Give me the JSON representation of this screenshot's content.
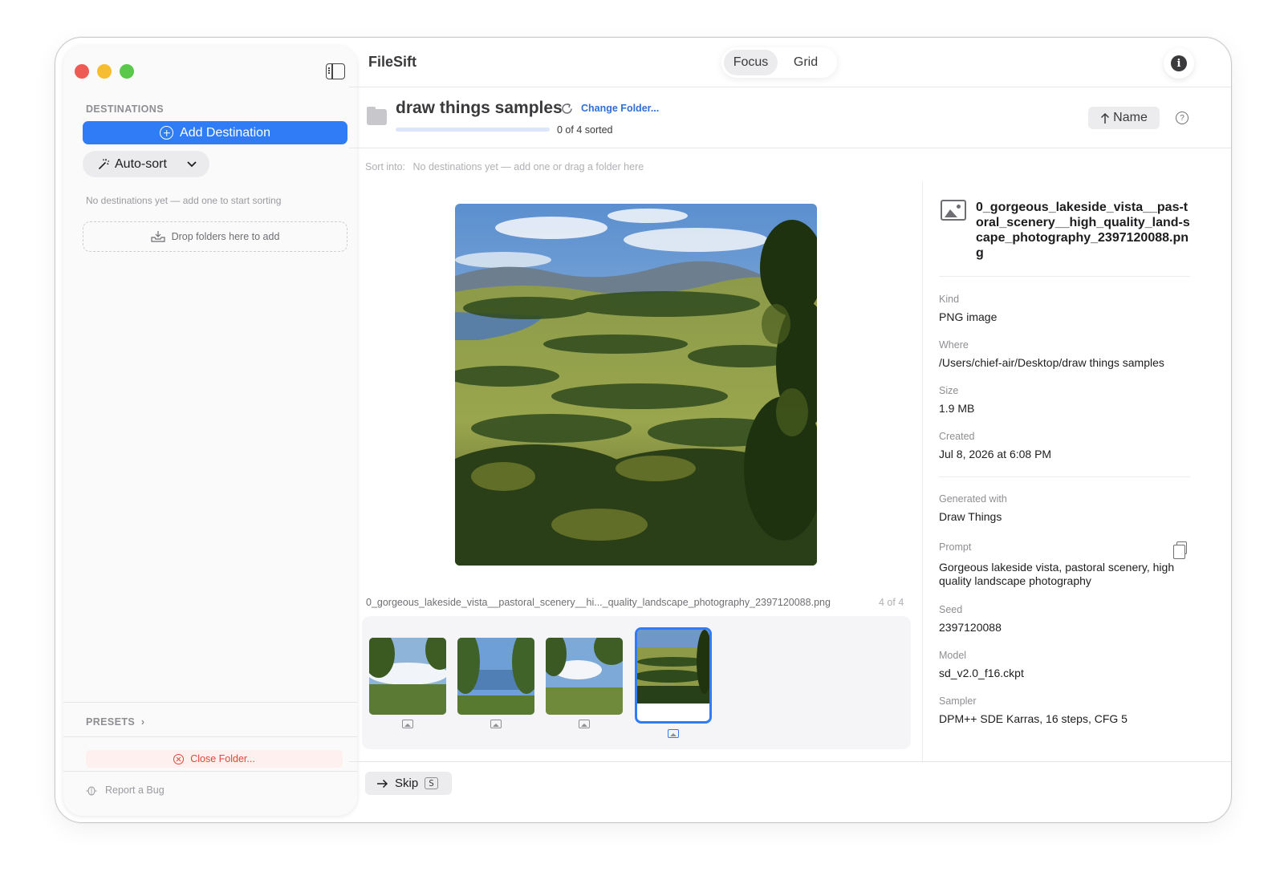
{
  "window": {
    "app_title": "FileSift",
    "view_modes": [
      {
        "label": "Focus",
        "active": true
      },
      {
        "label": "Grid",
        "active": false
      }
    ]
  },
  "sidebar": {
    "destinations_label": "DESTINATIONS",
    "add_destination_label": "Add Destination",
    "autosort_label": "Auto-sort",
    "empty_message": "No destinations yet — add one to start sorting",
    "dropzone_label": "Drop folders here to add",
    "presets_label": "PRESETS",
    "close_folder_label": "Close Folder...",
    "report_bug_label": "Report a Bug"
  },
  "folder": {
    "name": "draw things samples",
    "change_folder_label": "Change Folder...",
    "sorted_text": "0 of 4 sorted",
    "sorted_fraction": 0.0,
    "sort_button_label": "Name",
    "sort_into_label": "Sort into:",
    "sort_into_message": "No destinations yet — add one or drag a folder here"
  },
  "viewer": {
    "caption": "0_gorgeous_lakeside_vista__pastoral_scenery__hi..._quality_landscape_photography_2397120088.png",
    "position": "4 of 4",
    "thumbnails": [
      {
        "selected": false
      },
      {
        "selected": false
      },
      {
        "selected": false
      },
      {
        "selected": true
      }
    ],
    "skip_label": "Skip",
    "skip_shortcut": "S"
  },
  "info": {
    "file_name": "0_gorgeous_lakeside_vista__pas-toral_scenery__high_quality_land-scape_photography_2397120088.png",
    "kind_label": "Kind",
    "kind_value": "PNG image",
    "where_label": "Where",
    "where_value": "/Users/chief-air/Desktop/draw things samples",
    "size_label": "Size",
    "size_value": "1.9 MB",
    "created_label": "Created",
    "created_value": "Jul 8, 2026 at 6:08 PM",
    "generated_label": "Generated with",
    "generated_value": "Draw Things",
    "prompt_label": "Prompt",
    "prompt_value": "Gorgeous lakeside vista, pastoral scenery, high quality landscape photography",
    "seed_label": "Seed",
    "seed_value": "2397120088",
    "model_label": "Model",
    "model_value": "sd_v2.0_f16.ckpt",
    "sampler_label": "Sampler",
    "sampler_value": "DPM++ SDE Karras, 16 steps, CFG 5"
  }
}
